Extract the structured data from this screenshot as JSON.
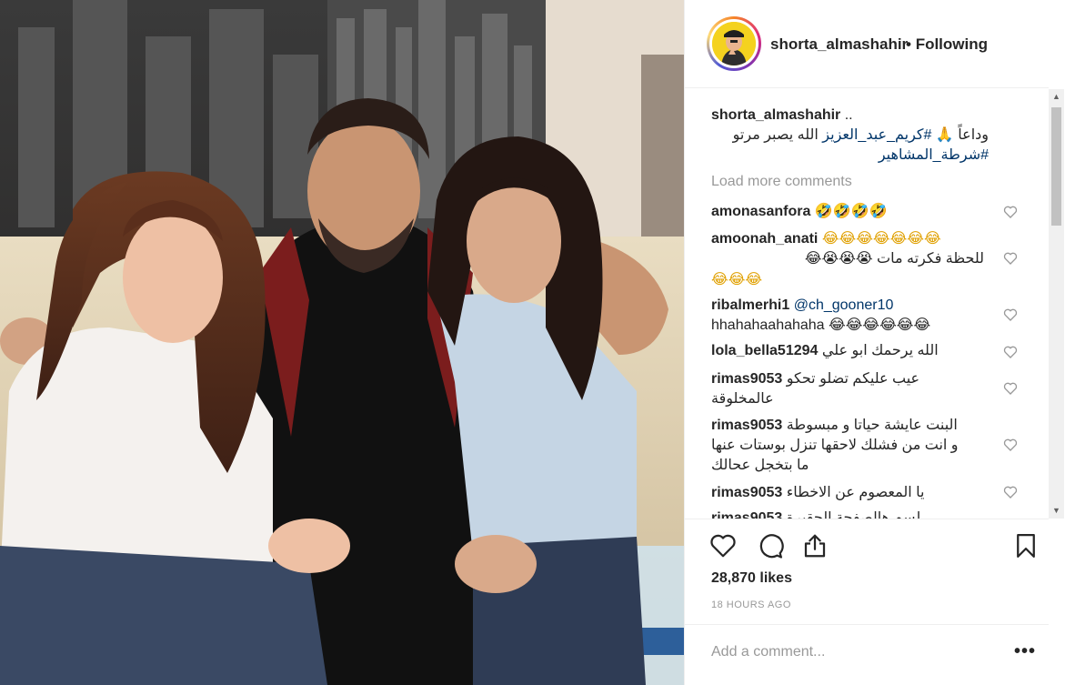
{
  "header": {
    "username": "shorta_almashahir",
    "separator": "•",
    "follow_status": "Following"
  },
  "caption": {
    "username": "shorta_almashahir",
    "after_user": "..",
    "line1_text": "وداعاً 🙏",
    "hashtag1": "#كريم_عبد_العزيز",
    "line1_rest": "الله يصبر مرتو",
    "hashtag2": "#شرطة_المشاهير"
  },
  "load_more": "Load more comments",
  "comments": [
    {
      "user": "amonasanfora",
      "text": "🤣🤣🤣🤣"
    },
    {
      "user": "amoonah_anati",
      "text": "😂😂😂😂😂😂😂",
      "text2": "للحظة فكرته مات 😭😭😭😂",
      "text3": "😂😂😂"
    },
    {
      "user": "ribalmerhi1",
      "mention": "@ch_gooner10",
      "text": "hhahahaahahaha 😂😂😂😂😂😂"
    },
    {
      "user": "lola_bella51294",
      "text": "الله يرحمك ابو علي"
    },
    {
      "user": "rimas9053",
      "text": "عيب عليكم تضلو تحكو",
      "text2": "عالمخلوقة"
    },
    {
      "user": "rimas9053",
      "text": "البنت عايشة حياتا و مبسوطة",
      "text2": "و انت من فشلك لاحقها تنزل بوستات عنها",
      "text3": "ما بتخجل عحالك"
    },
    {
      "user": "rimas9053",
      "text": "يا المعصوم عن الاخطاء"
    },
    {
      "user": "rimas9053",
      "text": "لسم هالصفحة الحقيرة"
    }
  ],
  "likes": "28,870 likes",
  "timestamp": "18 HOURS AGO",
  "add_comment": {
    "placeholder": "Add a comment..."
  },
  "more_options": "•••",
  "icons": {
    "like": "heart-icon",
    "comment": "comment-icon",
    "share": "share-icon",
    "save": "bookmark-icon"
  }
}
